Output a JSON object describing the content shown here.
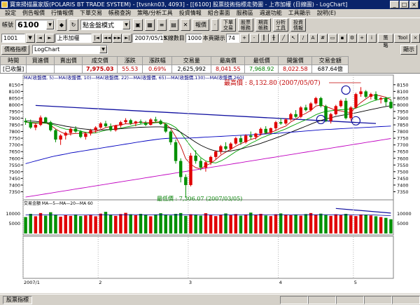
{
  "window": {
    "title": "寶來掃描贏家版(POLARIS BT TRADE SYSTEM) - [tvsnkn03, 4093] - [[6100] 股票技術指標走勢圖 - 上市加權 (日線圖) - LogChart]"
  },
  "menu": [
    "設定",
    "例告報價",
    "行情報價",
    "下單交易",
    "帳務查詢",
    "策略/分析工具",
    "投資情報",
    "組合畫面",
    "服務區",
    "週邊功能",
    "工具顯示",
    "說明(E)"
  ],
  "toolbar": {
    "account_label": "帳號",
    "account_value": "6100",
    "mode_value": "點金盤模式",
    "quote_button": "報價",
    "buttons": [
      {
        "top": "下單",
        "bottom": "交易"
      },
      {
        "top": "股票",
        "bottom": "帳務"
      },
      {
        "top": "期貨",
        "bottom": "帳務"
      },
      {
        "top": "分析",
        "bottom": "工具"
      },
      {
        "top": "投資",
        "bottom": "情報"
      }
    ]
  },
  "chart_toolbar": {
    "code": "1001",
    "name": "上市加權",
    "date": "2007/05/15",
    "line_count_label": "K線數目",
    "line_count": "1000",
    "display_label": "本頁顯示",
    "display_value": "74",
    "strategy_button": "策略",
    "tool_button": "Tool",
    "price_indicator_button": "價格指標",
    "chart_type": "LogChart",
    "show_button": "顯示"
  },
  "quote": {
    "headers": [
      "時間",
      "買進價",
      "賣出價",
      "成交價",
      "漲跌",
      "漲跌幅",
      "交易量",
      "最高價",
      "最低價",
      "開盤價",
      "交易金額"
    ],
    "values": [
      "[已收盤]",
      "",
      "",
      "7,975.03",
      "55.53",
      "0.69%",
      "2,625,992",
      "8,041.55",
      "7,968.92",
      "8,022.58",
      "687.64億"
    ]
  },
  "chart_data": {
    "type": "candlestick",
    "legend": "MA(收盤價, 5)—MA(收盤價, 10)—MA(收盤價, 22)—MA(收盤價, 65)—MA(收盤價,130)—MA(收盤價,260)",
    "annotation_high": "最高價 : 8,132.80 (2007/05/07)",
    "annotation_low": "最低價 : 7,306.07 (2007/03/05)",
    "ylim": [
      7300,
      8170
    ],
    "y_ticks": [
      8150,
      8100,
      8050,
      8000,
      7950,
      7900,
      7850,
      7800,
      7750,
      7700,
      7650,
      7600,
      7550,
      7500,
      7450,
      7400,
      7350
    ],
    "x_ticks": [
      {
        "label": "2007/1",
        "index": 0
      },
      {
        "label": "2",
        "index": 15
      },
      {
        "label": "3",
        "index": 33
      },
      {
        "label": "4",
        "index": 51
      },
      {
        "label": "5",
        "index": 66
      }
    ],
    "candles": [
      [
        7880,
        7900,
        7850,
        7870
      ],
      [
        7870,
        7890,
        7820,
        7830
      ],
      [
        7830,
        7860,
        7810,
        7850
      ],
      [
        7850,
        7920,
        7840,
        7905
      ],
      [
        7905,
        7910,
        7860,
        7870
      ],
      [
        7870,
        7880,
        7800,
        7810
      ],
      [
        7810,
        7820,
        7720,
        7740
      ],
      [
        7740,
        7780,
        7700,
        7770
      ],
      [
        7770,
        7800,
        7740,
        7790
      ],
      [
        7790,
        7830,
        7770,
        7820
      ],
      [
        7820,
        7840,
        7790,
        7800
      ],
      [
        7800,
        7810,
        7750,
        7760
      ],
      [
        7760,
        7790,
        7740,
        7785
      ],
      [
        7785,
        7820,
        7770,
        7810
      ],
      [
        7810,
        7840,
        7790,
        7830
      ],
      [
        7830,
        7870,
        7820,
        7860
      ],
      [
        7860,
        7880,
        7830,
        7840
      ],
      [
        7840,
        7860,
        7800,
        7810
      ],
      [
        7810,
        7850,
        7800,
        7845
      ],
      [
        7845,
        7880,
        7830,
        7870
      ],
      [
        7870,
        7900,
        7860,
        7885
      ],
      [
        7885,
        7895,
        7850,
        7860
      ],
      [
        7860,
        7880,
        7840,
        7875
      ],
      [
        7875,
        7890,
        7855,
        7865
      ],
      [
        7865,
        7880,
        7840,
        7850
      ],
      [
        7850,
        7900,
        7845,
        7890
      ],
      [
        7890,
        7910,
        7870,
        7880
      ],
      [
        7880,
        7890,
        7850,
        7855
      ],
      [
        7855,
        7860,
        7790,
        7800
      ],
      [
        7800,
        7810,
        7700,
        7720
      ],
      [
        7720,
        7740,
        7560,
        7580
      ],
      [
        7580,
        7600,
        7420,
        7460
      ],
      [
        7460,
        7480,
        7306,
        7400
      ],
      [
        7400,
        7640,
        7390,
        7620
      ],
      [
        7620,
        7660,
        7560,
        7580
      ],
      [
        7580,
        7600,
        7510,
        7530
      ],
      [
        7530,
        7580,
        7500,
        7570
      ],
      [
        7570,
        7620,
        7550,
        7610
      ],
      [
        7610,
        7660,
        7590,
        7650
      ],
      [
        7650,
        7700,
        7630,
        7690
      ],
      [
        7690,
        7720,
        7660,
        7670
      ],
      [
        7670,
        7720,
        7660,
        7710
      ],
      [
        7710,
        7760,
        7700,
        7750
      ],
      [
        7750,
        7770,
        7700,
        7720
      ],
      [
        7720,
        7780,
        7710,
        7770
      ],
      [
        7770,
        7800,
        7740,
        7760
      ],
      [
        7760,
        7790,
        7740,
        7785
      ],
      [
        7785,
        7830,
        7770,
        7820
      ],
      [
        7820,
        7840,
        7780,
        7790
      ],
      [
        7790,
        7830,
        7780,
        7825
      ],
      [
        7825,
        7880,
        7810,
        7870
      ],
      [
        7870,
        7900,
        7850,
        7860
      ],
      [
        7860,
        7900,
        7850,
        7890
      ],
      [
        7890,
        7940,
        7880,
        7930
      ],
      [
        7930,
        7960,
        7900,
        7910
      ],
      [
        7910,
        7990,
        7900,
        7980
      ],
      [
        7980,
        8000,
        7950,
        7960
      ],
      [
        7960,
        8020,
        7950,
        8010
      ],
      [
        8010,
        8060,
        8000,
        8050
      ],
      [
        8050,
        8060,
        7980,
        7990
      ],
      [
        7990,
        8000,
        7870,
        7880
      ],
      [
        7880,
        7940,
        7860,
        7930
      ],
      [
        7930,
        8000,
        7920,
        7990
      ],
      [
        7990,
        8040,
        7980,
        8030
      ],
      [
        8030,
        8050,
        7890,
        7900
      ],
      [
        7900,
        7990,
        7880,
        7980
      ],
      [
        7980,
        8090,
        7970,
        8080
      ],
      [
        8080,
        8132,
        8060,
        8100
      ],
      [
        8100,
        8110,
        8050,
        8060
      ],
      [
        8060,
        8090,
        8040,
        8080
      ],
      [
        8080,
        8100,
        8030,
        8040
      ],
      [
        8040,
        8060,
        8010,
        8050
      ],
      [
        8050,
        8060,
        7990,
        8020
      ],
      [
        8022,
        8041,
        7969,
        7975
      ]
    ],
    "ma_series": [
      {
        "name": "MA5",
        "color": "#c00000",
        "values": [
          7870,
          7865,
          7860,
          7865,
          7865,
          7847,
          7819,
          7798,
          7780,
          7782,
          7786,
          7786,
          7791,
          7794,
          7801,
          7813,
          7830,
          7837,
          7846,
          7849,
          7858,
          7856,
          7865,
          7870,
          7867,
          7866,
          7871,
          7872,
          7856,
          7822,
          7762,
          7692,
          7597,
          7556,
          7530,
          7520,
          7546,
          7562,
          7590,
          7623,
          7646,
          7668,
          7690,
          7710,
          7724,
          7741,
          7752,
          7777,
          7787,
          7793,
          7808,
          7827,
          7841,
          7872,
          7892,
          7918,
          7936,
          7958,
          7990,
          7998,
          7986,
          7974,
          7958,
          7954,
          7946,
          7941,
          7985,
          8017,
          8044,
          8070,
          8073,
          8066,
          8056,
          8037
        ]
      },
      {
        "name": "MA10",
        "color": "#00a000",
        "values": [
          7870,
          7868,
          7866,
          7864,
          7862,
          7858,
          7845,
          7830,
          7818,
          7814,
          7810,
          7803,
          7795,
          7787,
          7790,
          7800,
          7810,
          7815,
          7820,
          7825,
          7833,
          7840,
          7848,
          7855,
          7860,
          7862,
          7866,
          7868,
          7865,
          7852,
          7830,
          7792,
          7740,
          7690,
          7645,
          7605,
          7580,
          7570,
          7565,
          7580,
          7600,
          7625,
          7650,
          7670,
          7690,
          7712,
          7730,
          7750,
          7765,
          7780,
          7792,
          7805,
          7820,
          7838,
          7855,
          7872,
          7888,
          7905,
          7925,
          7940,
          7950,
          7955,
          7960,
          7963,
          7965,
          7968,
          7975,
          7990,
          8005,
          8022,
          8035,
          8043,
          8050,
          8055
        ]
      },
      {
        "name": "MA22",
        "color": "#000000",
        "values": [
          7880,
          7878,
          7876,
          7872,
          7868,
          7862,
          7855,
          7848,
          7840,
          7834,
          7828,
          7822,
          7818,
          7814,
          7812,
          7812,
          7813,
          7815,
          7818,
          7821,
          7824,
          7828,
          7830,
          7832,
          7833,
          7834,
          7835,
          7835,
          7832,
          7826,
          7815,
          7795,
          7770,
          7745,
          7720,
          7698,
          7680,
          7665,
          7655,
          7650,
          7650,
          7655,
          7662,
          7670,
          7680,
          7690,
          7700,
          7712,
          7725,
          7738,
          7752,
          7765,
          7780,
          7795,
          7810,
          7825,
          7840,
          7855,
          7870,
          7883,
          7894,
          7903,
          7912,
          7920,
          7927,
          7933,
          7940,
          7948,
          7956,
          7964,
          7972,
          7980,
          7987,
          7993
        ]
      },
      {
        "name": "MA65",
        "color": "#0000c0",
        "values": [
          7560,
          7570,
          7580,
          7590,
          7600,
          7610,
          7618,
          7625,
          7632,
          7640,
          7646,
          7652,
          7658,
          7664,
          7670,
          7676,
          7682,
          7688,
          7694,
          7700,
          7706,
          7712,
          7718,
          7724,
          7730,
          7735,
          7740,
          7745,
          7748,
          7750,
          7750,
          7750,
          7750,
          7752,
          7754,
          7756,
          7758,
          7760,
          7762,
          7764,
          7766,
          7768,
          7770,
          7772,
          7774,
          7776,
          7778,
          7780,
          7782,
          7784,
          7786,
          7789,
          7792,
          7795,
          7798,
          7801,
          7804,
          7807,
          7810,
          7813,
          7815,
          7817,
          7819,
          7821,
          7823,
          7825,
          7827,
          7829,
          7831,
          7833,
          7835,
          7837,
          7839,
          7841
        ]
      },
      {
        "name": "MA130",
        "color": "#c000c0",
        "values": [
          7310,
          7316,
          7322,
          7328,
          7334,
          7340,
          7346,
          7352,
          7358,
          7364,
          7370,
          7376,
          7382,
          7388,
          7394,
          7400,
          7406,
          7412,
          7418,
          7424,
          7430,
          7436,
          7442,
          7448,
          7454,
          7460,
          7466,
          7472,
          7478,
          7484,
          7490,
          7496,
          7502,
          7508,
          7514,
          7520,
          7526,
          7532,
          7538,
          7544,
          7550,
          7556,
          7562,
          7568,
          7574,
          7580,
          7586,
          7592,
          7598,
          7604,
          7610,
          7616,
          7622,
          7628,
          7634,
          7640,
          7646,
          7652,
          7658,
          7664,
          7670,
          7676,
          7682,
          7688,
          7694,
          7700,
          7706,
          7712,
          7718,
          7724,
          7730,
          7736,
          7742,
          7748
        ]
      }
    ],
    "volume": {
      "legend": "交易金額 MA—5—MA—20—MA 60",
      "ticks": [
        10000,
        5000
      ],
      "ylim": [
        0,
        14000
      ],
      "values": [
        8200,
        9800,
        8600,
        10200,
        8900,
        10600,
        9300,
        8400,
        9100,
        8800,
        9500,
        8700,
        9000,
        9200,
        8600,
        9900,
        10800,
        9400,
        8800,
        9700,
        10300,
        9600,
        9100,
        9800,
        9300,
        8600,
        9500,
        10100,
        9400,
        9000,
        9800,
        10200,
        8800,
        9600,
        9300,
        8900,
        10100,
        9200,
        8700,
        9400,
        10000,
        9100,
        9700,
        8900,
        9500,
        10400,
        9200,
        9800,
        9000,
        8700,
        9600,
        10000,
        9300,
        9100,
        9500,
        8900,
        9700,
        10200,
        9400,
        9900,
        9200,
        8800,
        9600,
        9100,
        9800,
        9000,
        8700,
        9500,
        9300,
        9000,
        8600,
        8200,
        7800,
        7100
      ],
      "ma": [
        9200,
        9300,
        9250,
        9300,
        9350,
        9300,
        9320,
        9280,
        9300,
        9310,
        9290,
        9300,
        9320,
        9330,
        9310,
        9340,
        9360,
        9350,
        9330,
        9340,
        9360,
        9380,
        9370,
        9360,
        9340,
        9330,
        9350,
        9370,
        9360,
        9340,
        9330,
        9350,
        9360,
        9340,
        9330,
        9320,
        9340,
        9330,
        9310,
        9320,
        9340,
        9330,
        9350,
        9340,
        9330,
        9360,
        9350,
        9360,
        9340,
        9320,
        9330,
        9350,
        9340,
        9330,
        9340,
        9330,
        9350,
        9370,
        9360,
        9380,
        9370,
        9350,
        9360,
        9340,
        9350,
        9340,
        9320,
        9310,
        9300,
        9260,
        9200,
        9100,
        9000,
        8880
      ]
    }
  },
  "status": {
    "left": "股票指標",
    "panels": [
      "",
      "",
      "",
      "",
      ""
    ]
  }
}
